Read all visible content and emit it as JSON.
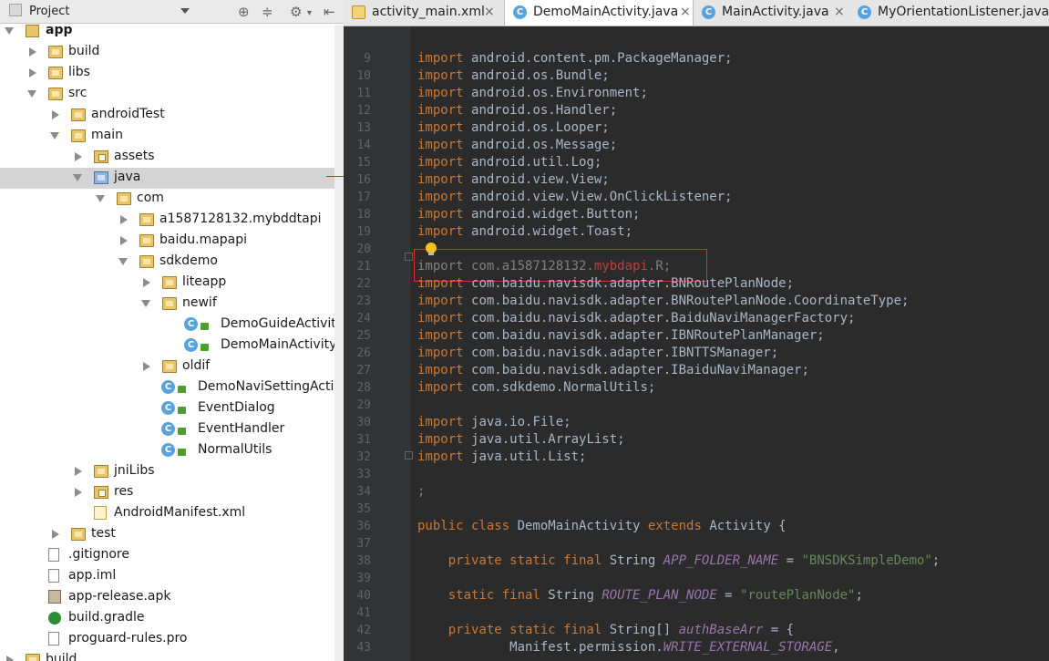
{
  "project_panel": {
    "title": "Project",
    "tree": [
      {
        "label": "app",
        "depth": 0,
        "icon": "module",
        "arrow": "exp",
        "bold": true
      },
      {
        "label": "build",
        "depth": 1,
        "icon": "folder",
        "arrow": "col"
      },
      {
        "label": "libs",
        "depth": 1,
        "icon": "folder",
        "arrow": "col"
      },
      {
        "label": "src",
        "depth": 1,
        "icon": "folder",
        "arrow": "exp"
      },
      {
        "label": "androidTest",
        "depth": 2,
        "icon": "folder",
        "arrow": "col"
      },
      {
        "label": "main",
        "depth": 2,
        "icon": "folder",
        "arrow": "exp"
      },
      {
        "label": "assets",
        "depth": 3,
        "icon": "pkg",
        "arrow": "col"
      },
      {
        "label": "java",
        "depth": 3,
        "icon": "folder-blue",
        "arrow": "exp",
        "selected": true
      },
      {
        "label": "com",
        "depth": 4,
        "icon": "folder",
        "arrow": "exp"
      },
      {
        "label": "a1587128132.mybddtapi",
        "depth": 5,
        "icon": "folder",
        "arrow": "col"
      },
      {
        "label": "baidu.mapapi",
        "depth": 5,
        "icon": "folder",
        "arrow": "col"
      },
      {
        "label": "sdkdemo",
        "depth": 5,
        "icon": "folder",
        "arrow": "exp"
      },
      {
        "label": "liteapp",
        "depth": 6,
        "icon": "folder",
        "arrow": "col"
      },
      {
        "label": "newif",
        "depth": 6,
        "icon": "folder",
        "arrow": "exp"
      },
      {
        "label": "DemoGuideActivity",
        "depth": 7,
        "icon": "class"
      },
      {
        "label": "DemoMainActivity",
        "depth": 7,
        "icon": "class"
      },
      {
        "label": "oldif",
        "depth": 6,
        "icon": "folder",
        "arrow": "col"
      },
      {
        "label": "DemoNaviSettingActivi",
        "depth": 6,
        "icon": "class"
      },
      {
        "label": "EventDialog",
        "depth": 6,
        "icon": "class"
      },
      {
        "label": "EventHandler",
        "depth": 6,
        "icon": "class"
      },
      {
        "label": "NormalUtils",
        "depth": 6,
        "icon": "class"
      },
      {
        "label": "jniLibs",
        "depth": 3,
        "icon": "folder",
        "arrow": "col"
      },
      {
        "label": "res",
        "depth": 3,
        "icon": "pkg",
        "arrow": "col"
      },
      {
        "label": "AndroidManifest.xml",
        "depth": 3,
        "icon": "xml"
      },
      {
        "label": "test",
        "depth": 2,
        "icon": "folder",
        "arrow": "col"
      },
      {
        "label": ".gitignore",
        "depth": 1,
        "icon": "file"
      },
      {
        "label": "app.iml",
        "depth": 1,
        "icon": "file"
      },
      {
        "label": "app-release.apk",
        "depth": 1,
        "icon": "apk"
      },
      {
        "label": "build.gradle",
        "depth": 1,
        "icon": "gradle"
      },
      {
        "label": "proguard-rules.pro",
        "depth": 1,
        "icon": "file"
      },
      {
        "label": "build",
        "depth": 0,
        "icon": "folder",
        "arrow": "col"
      }
    ]
  },
  "tabs": [
    {
      "label": "activity_main.xml",
      "icon": "xml-file-icon",
      "active": false
    },
    {
      "label": "DemoMainActivity.java",
      "icon": "class-icon",
      "active": true
    },
    {
      "label": "MainActivity.java",
      "icon": "class-icon",
      "active": false
    },
    {
      "label": "MyOrientationListener.java",
      "icon": "class-icon",
      "active": false
    }
  ],
  "editor": {
    "lines": [
      {
        "n": "9",
        "segs": [
          [
            "kw",
            "import "
          ],
          [
            "",
            "android.content.pm.PackageManager;"
          ]
        ]
      },
      {
        "n": "10",
        "segs": [
          [
            "kw",
            "import "
          ],
          [
            "",
            "android.os.Bundle;"
          ]
        ]
      },
      {
        "n": "11",
        "segs": [
          [
            "kw",
            "import "
          ],
          [
            "",
            "android.os.Environment;"
          ]
        ]
      },
      {
        "n": "12",
        "segs": [
          [
            "kw",
            "import "
          ],
          [
            "",
            "android.os.Handler;"
          ]
        ]
      },
      {
        "n": "13",
        "segs": [
          [
            "kw",
            "import "
          ],
          [
            "",
            "android.os.Looper;"
          ]
        ]
      },
      {
        "n": "14",
        "segs": [
          [
            "kw",
            "import "
          ],
          [
            "",
            "android.os.Message;"
          ]
        ]
      },
      {
        "n": "15",
        "segs": [
          [
            "kw",
            "import "
          ],
          [
            "",
            "android.util.Log;"
          ]
        ]
      },
      {
        "n": "16",
        "segs": [
          [
            "kw",
            "import "
          ],
          [
            "",
            "android.view.View;"
          ]
        ]
      },
      {
        "n": "17",
        "segs": [
          [
            "kw",
            "import "
          ],
          [
            "",
            "android.view.View.OnClickListener;"
          ]
        ]
      },
      {
        "n": "18",
        "segs": [
          [
            "kw",
            "import "
          ],
          [
            "",
            "android.widget.Button;"
          ]
        ]
      },
      {
        "n": "19",
        "segs": [
          [
            "kw",
            "import "
          ],
          [
            "",
            "android.widget.Toast;"
          ]
        ]
      },
      {
        "n": "20",
        "segs": []
      },
      {
        "n": "21",
        "segs": [
          [
            "dim",
            "import com.a1587128132."
          ],
          [
            "err",
            "mybdapi"
          ],
          [
            "dim",
            ".R;"
          ]
        ]
      },
      {
        "n": "22",
        "segs": [
          [
            "kw",
            "import "
          ],
          [
            "",
            "com.baidu.navisdk.adapter.BNRoutePlanNode;"
          ]
        ]
      },
      {
        "n": "23",
        "segs": [
          [
            "kw",
            "import "
          ],
          [
            "",
            "com.baidu.navisdk.adapter.BNRoutePlanNode.CoordinateType;"
          ]
        ]
      },
      {
        "n": "24",
        "segs": [
          [
            "kw",
            "import "
          ],
          [
            "",
            "com.baidu.navisdk.adapter.BaiduNaviManagerFactory;"
          ]
        ]
      },
      {
        "n": "25",
        "segs": [
          [
            "kw",
            "import "
          ],
          [
            "",
            "com.baidu.navisdk.adapter.IBNRoutePlanManager;"
          ]
        ]
      },
      {
        "n": "26",
        "segs": [
          [
            "kw",
            "import "
          ],
          [
            "",
            "com.baidu.navisdk.adapter.IBNTTSManager;"
          ]
        ]
      },
      {
        "n": "27",
        "segs": [
          [
            "kw",
            "import "
          ],
          [
            "",
            "com.baidu.navisdk.adapter.IBaiduNaviManager;"
          ]
        ]
      },
      {
        "n": "28",
        "segs": [
          [
            "kw",
            "import "
          ],
          [
            "",
            "com.sdkdemo.NormalUtils;"
          ]
        ]
      },
      {
        "n": "29",
        "segs": []
      },
      {
        "n": "30",
        "segs": [
          [
            "kw",
            "import "
          ],
          [
            "",
            "java.io.File;"
          ]
        ]
      },
      {
        "n": "31",
        "segs": [
          [
            "kw",
            "import "
          ],
          [
            "",
            "java.util.ArrayList;"
          ]
        ]
      },
      {
        "n": "32",
        "segs": [
          [
            "kw",
            "import "
          ],
          [
            "",
            "java.util.List;"
          ]
        ]
      },
      {
        "n": "33",
        "segs": []
      },
      {
        "n": "34",
        "segs": [
          [
            "dim",
            ";"
          ]
        ]
      },
      {
        "n": "35",
        "segs": []
      },
      {
        "n": "36",
        "segs": [
          [
            "kw",
            "public class "
          ],
          [
            "",
            "DemoMainActivity "
          ],
          [
            "kw",
            "extends "
          ],
          [
            "",
            "Activity {"
          ]
        ]
      },
      {
        "n": "37",
        "segs": []
      },
      {
        "n": "38",
        "segs": [
          [
            "",
            "    "
          ],
          [
            "kw",
            "private static final "
          ],
          [
            "",
            "String "
          ],
          [
            "it",
            "APP_FOLDER_NAME"
          ],
          [
            "",
            " = "
          ],
          [
            "str",
            "\"BNSDKSimpleDemo\""
          ],
          [
            "",
            ";"
          ]
        ]
      },
      {
        "n": "39",
        "segs": []
      },
      {
        "n": "40",
        "segs": [
          [
            "",
            "    "
          ],
          [
            "kw",
            "static final "
          ],
          [
            "",
            "String "
          ],
          [
            "it",
            "ROUTE_PLAN_NODE"
          ],
          [
            "",
            " = "
          ],
          [
            "str",
            "\"routePlanNode\""
          ],
          [
            "",
            ";"
          ]
        ]
      },
      {
        "n": "41",
        "segs": []
      },
      {
        "n": "42",
        "segs": [
          [
            "",
            "    "
          ],
          [
            "kw",
            "private static final "
          ],
          [
            "",
            "String[] "
          ],
          [
            "it",
            "authBaseArr"
          ],
          [
            "",
            " = {"
          ]
        ]
      },
      {
        "n": "43",
        "segs": [
          [
            "",
            "            Manifest.permission."
          ],
          [
            "it",
            "WRITE_EXTERNAL_STORAGE"
          ],
          [
            "",
            ","
          ]
        ]
      }
    ]
  }
}
